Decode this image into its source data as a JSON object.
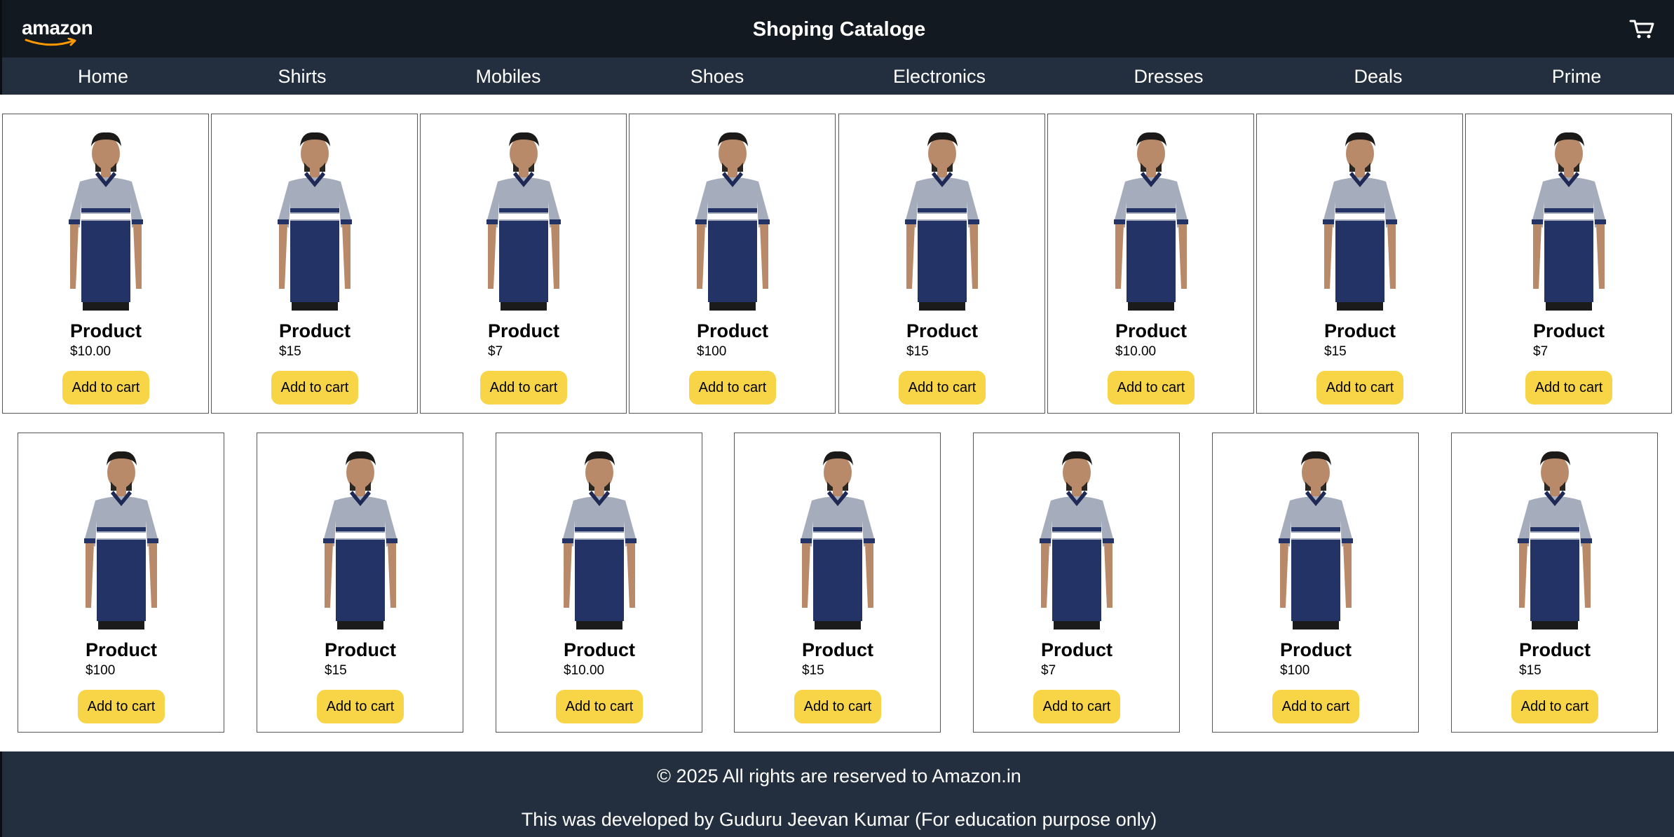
{
  "header": {
    "logo_text": "amazon",
    "title": "Shoping Cataloge",
    "cart_icon": "cart-icon"
  },
  "nav": {
    "items": [
      "Home",
      "Shirts",
      "Mobiles",
      "Shoes",
      "Electronics",
      "Dresses",
      "Deals",
      "Prime"
    ]
  },
  "products": [
    {
      "name": "Product",
      "price": "$10.00",
      "button": "Add to cart"
    },
    {
      "name": "Product",
      "price": "$15",
      "button": "Add to cart"
    },
    {
      "name": "Product",
      "price": "$7",
      "button": "Add to cart"
    },
    {
      "name": "Product",
      "price": "$100",
      "button": "Add to cart"
    },
    {
      "name": "Product",
      "price": "$15",
      "button": "Add to cart"
    },
    {
      "name": "Product",
      "price": "$10.00",
      "button": "Add to cart"
    },
    {
      "name": "Product",
      "price": "$15",
      "button": "Add to cart"
    },
    {
      "name": "Product",
      "price": "$7",
      "button": "Add to cart"
    },
    {
      "name": "Product",
      "price": "$100",
      "button": "Add to cart"
    },
    {
      "name": "Product",
      "price": "$15",
      "button": "Add to cart"
    },
    {
      "name": "Product",
      "price": "$10.00",
      "button": "Add to cart"
    },
    {
      "name": "Product",
      "price": "$15",
      "button": "Add to cart"
    },
    {
      "name": "Product",
      "price": "$7",
      "button": "Add to cart"
    },
    {
      "name": "Product",
      "price": "$100",
      "button": "Add to cart"
    },
    {
      "name": "Product",
      "price": "$15",
      "button": "Add to cart"
    }
  ],
  "footer": {
    "copyright": "© 2025 All rights are reserved to Amazon.in",
    "credit": "This was developed by Guduru Jeevan Kumar (For education purpose only)"
  },
  "colors": {
    "header_bg": "#131921",
    "nav_bg": "#232f3e",
    "footer_bg": "#232f3e",
    "button_bg": "#f7d547",
    "logo_smile": "#ff9900"
  }
}
